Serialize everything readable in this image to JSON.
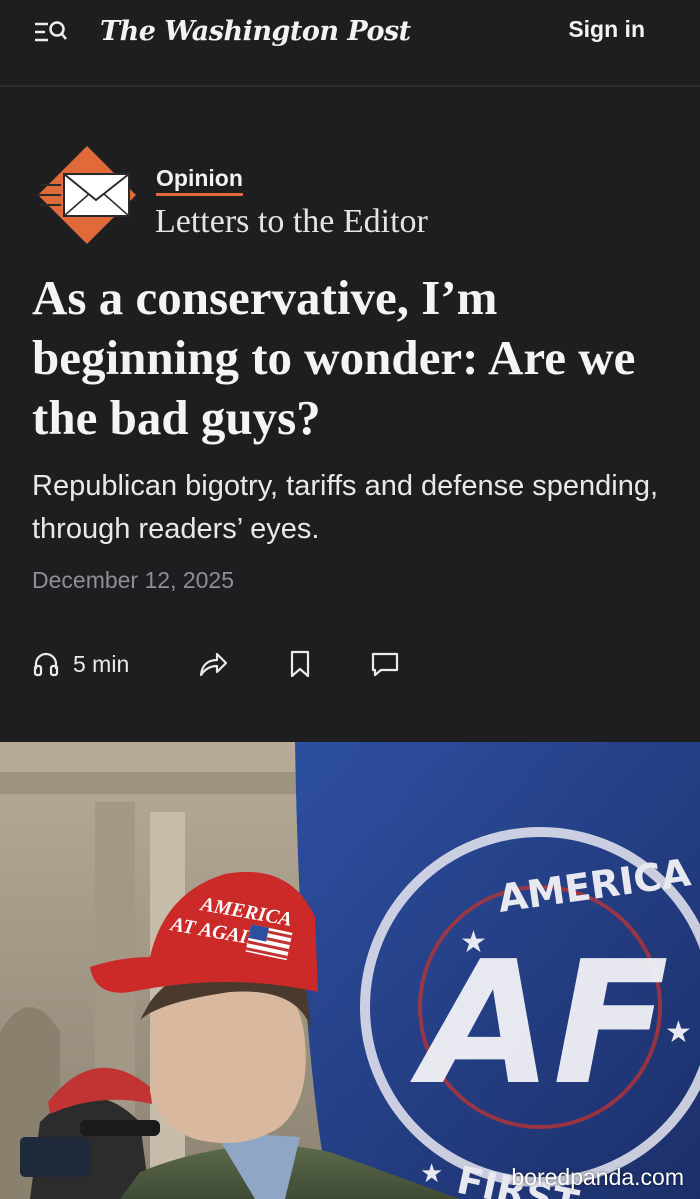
{
  "header": {
    "masthead": "The Washington Post",
    "sign_in_label": "Sign in",
    "menu_icon": "menu-search-icon"
  },
  "article": {
    "section": "Opinion",
    "column": "Letters to the Editor",
    "headline": "As a conservative, I’m beginning to wonder: Are we the bad guys?",
    "dek": "Republican bigotry, tariffs and defense spending, through readers’ eyes.",
    "date": "December 12, 2025",
    "listen_label": "5 min",
    "action_icons": [
      "headphones-icon",
      "share-icon",
      "bookmark-icon",
      "comment-icon"
    ]
  },
  "photo": {
    "cap_text_line1": "AMERICA",
    "cap_text_line2": "AT AGAIN",
    "flag_text_top": "AMERICA",
    "flag_text_bottom": "FIRST",
    "flag_logo": "AF",
    "watermark": "boredpanda.com"
  },
  "colors": {
    "background": "#1e1e20",
    "accent": "#e06a3a",
    "text": "#f2f2f2",
    "muted": "#8f8f93"
  }
}
